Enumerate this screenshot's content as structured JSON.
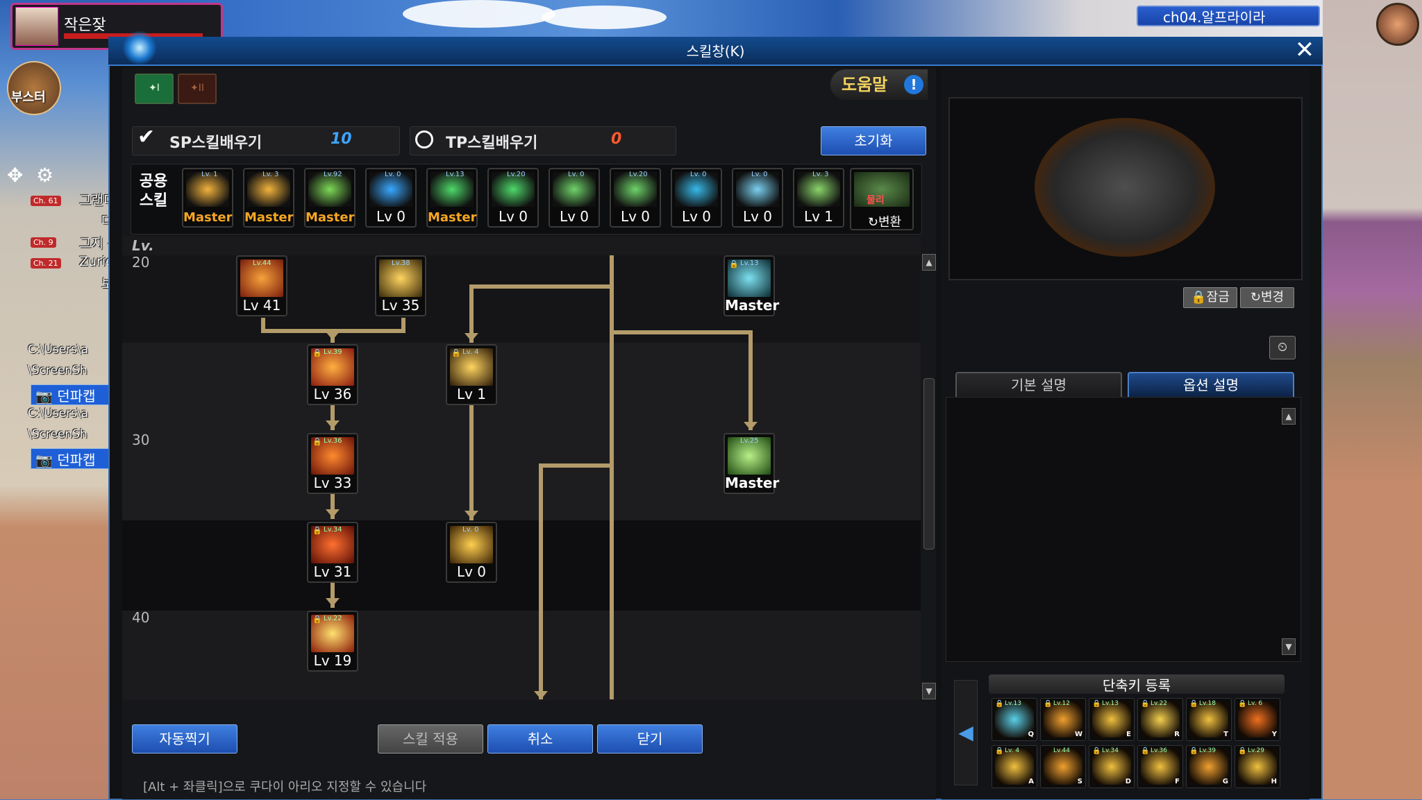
{
  "character": {
    "name": "작은잦"
  },
  "booster": {
    "label": "부스터"
  },
  "channel": {
    "name": "ch04.알프라이라"
  },
  "side": {
    "lines": [
      "그랜디",
      "다",
      "그지 -",
      "Zurie",
      "보"
    ],
    "channel_badges": [
      "Ch. 61",
      "Ch. 9",
      "Ch. 21"
    ],
    "paths": [
      "C:\\Users\\a",
      "\\ScreenSh",
      "C:\\Users\\a",
      "\\ScreenSh"
    ],
    "capture_buttons": [
      "던파캡",
      "던파캡"
    ]
  },
  "window": {
    "title": "스킬창(K)",
    "close": "✕"
  },
  "tabs": {
    "tab1": "I",
    "tab2": "II"
  },
  "help": {
    "label": "도움말",
    "icon": "!"
  },
  "points": {
    "sp_label": "SP스킬배우기",
    "sp_value": "10",
    "tp_label": "TP스킬배우기",
    "tp_value": "0",
    "reset": "초기화"
  },
  "common_skills": {
    "label_line1": "공용",
    "label_line2": "스킬",
    "items": [
      {
        "tag": "Lv. 1",
        "lv": "Master",
        "master": true,
        "icon": "flame-icon"
      },
      {
        "tag": "Lv. 3",
        "lv": "Master",
        "master": true,
        "icon": "flame-icon"
      },
      {
        "tag": "Lv.92",
        "lv": "Master",
        "master": true,
        "icon": "leaf-icon"
      },
      {
        "tag": "Lv. 0",
        "lv": "Lv 0",
        "master": false,
        "icon": "wing-icon"
      },
      {
        "tag": "Lv.13",
        "lv": "Master",
        "master": true,
        "icon": "target-icon"
      },
      {
        "tag": "Lv.20",
        "lv": "Lv 0",
        "master": false,
        "icon": "target-icon"
      },
      {
        "tag": "Lv. 0",
        "lv": "Lv 0",
        "master": false,
        "icon": "leaf-icon"
      },
      {
        "tag": "Lv.20",
        "lv": "Lv 0",
        "master": false,
        "icon": "leaf-icon"
      },
      {
        "tag": "Lv. 0",
        "lv": "Lv 0",
        "master": false,
        "icon": "eye-icon"
      },
      {
        "tag": "Lv. 0",
        "lv": "Lv 0",
        "master": false,
        "icon": "figure-icon"
      },
      {
        "tag": "Lv. 3",
        "lv": "Lv 1",
        "master": false,
        "icon": "leaf-icon"
      }
    ],
    "convert_icon_text": "물리",
    "convert": "↻변환"
  },
  "tree": {
    "lv_header": "Lv.",
    "level_labels": [
      "20",
      "30",
      "40"
    ],
    "nodes": [
      {
        "id": "n41",
        "tag": "Lv.44",
        "lv": "Lv 41",
        "master": false,
        "locked": false
      },
      {
        "id": "n35",
        "tag": "Lv.38",
        "lv": "Lv 35",
        "master": false,
        "locked": false
      },
      {
        "id": "n13",
        "tag": "Lv.13",
        "lv": "Master",
        "master": true,
        "locked": true
      },
      {
        "id": "n36",
        "tag": "Lv.39",
        "lv": "Lv 36",
        "master": false,
        "locked": true
      },
      {
        "id": "n1",
        "tag": "Lv. 4",
        "lv": "Lv 1",
        "master": false,
        "locked": true
      },
      {
        "id": "n33",
        "tag": "Lv.36",
        "lv": "Lv 33",
        "master": false,
        "locked": true
      },
      {
        "id": "n25",
        "tag": "Lv.25",
        "lv": "Master",
        "master": true,
        "locked": false
      },
      {
        "id": "n31",
        "tag": "Lv.34",
        "lv": "Lv 31",
        "master": false,
        "locked": true
      },
      {
        "id": "n0",
        "tag": "Lv. 0",
        "lv": "Lv 0",
        "master": false,
        "locked": false
      },
      {
        "id": "n19",
        "tag": "Lv.22",
        "lv": "Lv 19",
        "master": false,
        "locked": true
      }
    ]
  },
  "buttons": {
    "auto": "자동찍기",
    "apply": "스킬 적용",
    "cancel": "취소",
    "close": "닫기"
  },
  "info_text": "[Alt + 좌클릭]으로 쿠다이 아리오 지정할 수 있습니다",
  "preview": {
    "lock": "🔒잠금",
    "change": "↻변경",
    "clock_icon": "⏲"
  },
  "desc_tabs": {
    "basic": "기본 설명",
    "option": "옵션 설명"
  },
  "shortcut": {
    "title": "단축키 등록",
    "slots": [
      {
        "tag": "Lv.13",
        "key": "Q",
        "locked": true
      },
      {
        "tag": "Lv.12",
        "key": "W",
        "locked": true
      },
      {
        "tag": "Lv.13",
        "key": "E",
        "locked": true
      },
      {
        "tag": "Lv.22",
        "key": "R",
        "locked": true
      },
      {
        "tag": "Lv.18",
        "key": "T",
        "locked": true
      },
      {
        "tag": "Lv. 6",
        "key": "Y",
        "locked": true
      },
      {
        "tag": "Lv. 4",
        "key": "A",
        "locked": true
      },
      {
        "tag": "Lv.44",
        "key": "S",
        "locked": false
      },
      {
        "tag": "Lv.34",
        "key": "D",
        "locked": true
      },
      {
        "tag": "Lv.36",
        "key": "F",
        "locked": true
      },
      {
        "tag": "Lv.39",
        "key": "G",
        "locked": true
      },
      {
        "tag": "Lv.29",
        "key": "H",
        "locked": true
      }
    ]
  },
  "colors": {
    "accent": "#1d4eb0",
    "tree_line": "#b39b6a",
    "master": "#f6a623",
    "sp": "#3da5ff",
    "tp": "#ff5a2a"
  }
}
